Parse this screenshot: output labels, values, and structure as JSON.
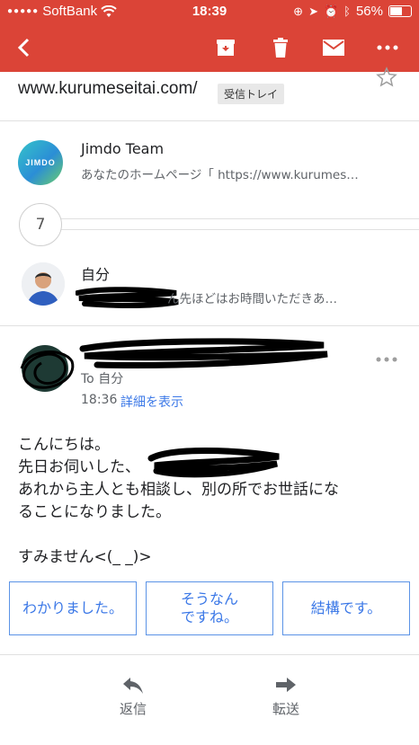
{
  "status_bar": {
    "carrier": "SoftBank",
    "time": "18:39",
    "battery": "56%",
    "battery_level": 0.56
  },
  "toolbar": {
    "back_icon": "arrow-back-icon",
    "archive_icon": "archive-icon",
    "delete_icon": "trash-icon",
    "mark_unread_icon": "mail-icon",
    "more_icon": "more-horiz-icon"
  },
  "thread": {
    "subject": "www.kurumeseitai.com/",
    "label": "受信トレイ",
    "collapsed_count": "7"
  },
  "messages": [
    {
      "sender": "Jimdo Team",
      "avatar_text": "JIMDO",
      "snippet": "あなたのホームページ「 https://www.kurumes…"
    },
    {
      "sender": "自分",
      "snippet": "ん先ほどはお時間いただきあ…"
    }
  ],
  "open_message": {
    "to": "To 自分",
    "time": "18:36",
    "details_link": "詳細を表示",
    "body": [
      "こんにちは。",
      "先日お伺いした、",
      "あれから主人とも相談し、別の所でお世話にな",
      "ることになりました。",
      "",
      "すみません<(_ _)>"
    ]
  },
  "smart_replies": [
    "わかりました。",
    "そうなん\nですね。",
    "結構です。"
  ],
  "bottom_actions": {
    "reply": "返信",
    "forward": "転送"
  },
  "colors": {
    "accent": "#db4437",
    "link": "#3b78e7"
  }
}
